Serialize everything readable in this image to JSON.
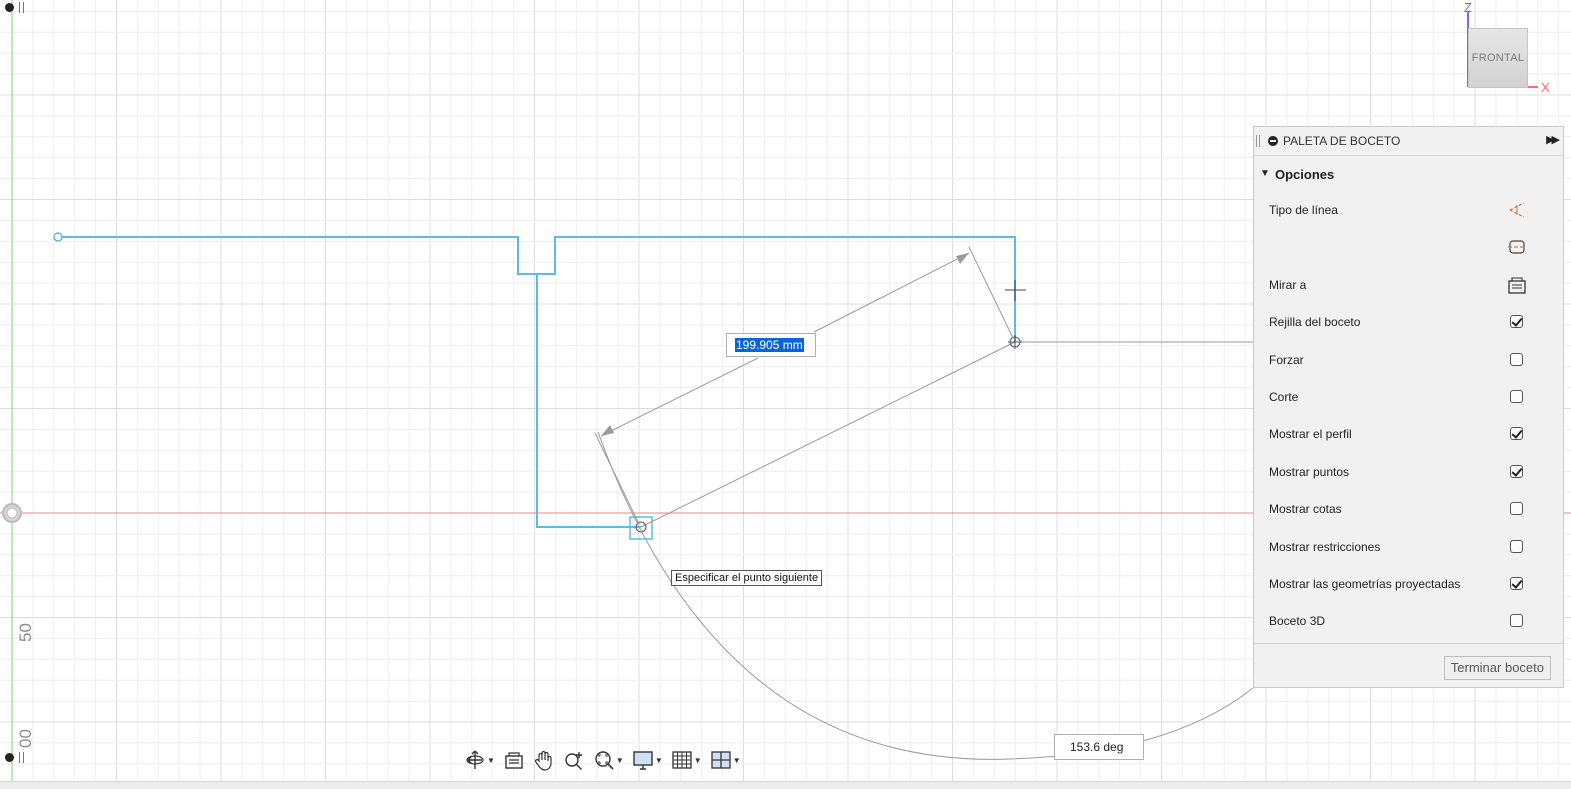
{
  "canvas": {
    "dimension_length": "199.905 mm",
    "dimension_angle": "153.6 deg",
    "tooltip": "Especificar el punto siguiente",
    "ruler_labels": [
      "50",
      "00"
    ]
  },
  "viewcube": {
    "face_label": "FRONTAL",
    "axis_z": "Z",
    "axis_x": "X"
  },
  "palette": {
    "title": "PALETA DE BOCETO",
    "section": "Opciones",
    "rows": [
      {
        "label": "Tipo de línea",
        "control": "icon",
        "icon": "construction-line-icon"
      },
      {
        "label": "",
        "control": "icon",
        "icon": "centerline-icon"
      },
      {
        "label": "Mirar a",
        "control": "icon",
        "icon": "look-at-icon"
      },
      {
        "label": "Rejilla del boceto",
        "control": "checkbox",
        "checked": true
      },
      {
        "label": "Forzar",
        "control": "checkbox",
        "checked": false
      },
      {
        "label": "Corte",
        "control": "checkbox",
        "checked": false
      },
      {
        "label": "Mostrar el perfil",
        "control": "checkbox",
        "checked": true
      },
      {
        "label": "Mostrar puntos",
        "control": "checkbox",
        "checked": true
      },
      {
        "label": "Mostrar cotas",
        "control": "checkbox",
        "checked": false
      },
      {
        "label": "Mostrar restricciones",
        "control": "checkbox",
        "checked": false
      },
      {
        "label": "Mostrar las geometrías proyectadas",
        "control": "checkbox",
        "checked": true
      },
      {
        "label": "Boceto 3D",
        "control": "checkbox",
        "checked": false
      }
    ],
    "finish_label": "Terminar boceto"
  },
  "toolbar": {
    "items": [
      {
        "name": "orbit-icon",
        "has_menu": true
      },
      {
        "name": "look-at-icon",
        "has_menu": false
      },
      {
        "name": "pan-icon",
        "has_menu": false
      },
      {
        "name": "zoom-icon",
        "has_menu": false
      },
      {
        "name": "fit-zoom-icon",
        "has_menu": true
      },
      {
        "name": "display-settings-icon",
        "has_menu": true
      },
      {
        "name": "grid-settings-icon",
        "has_menu": true
      },
      {
        "name": "viewports-icon",
        "has_menu": true
      }
    ]
  },
  "colors": {
    "sketch_line": "#5bbbe5",
    "axis_x": "#f08080",
    "axis_y": "#7ad67a",
    "selection": "#0a64d6"
  }
}
